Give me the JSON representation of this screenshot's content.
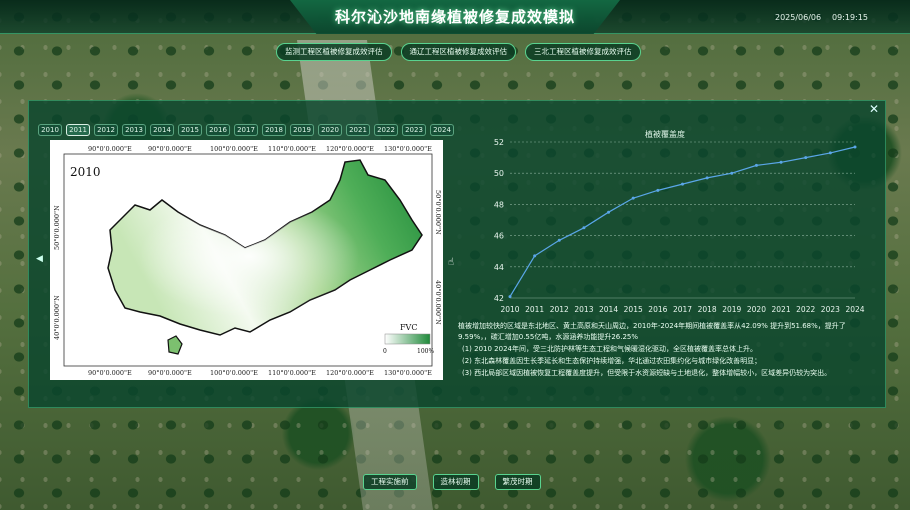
{
  "header": {
    "title": "科尔沁沙地南缘植被修复成效模拟",
    "date": "2025/06/06",
    "time": "09:19:15"
  },
  "top_buttons": [
    "监测工程区植被修复成效评估",
    "通辽工程区植被修复成效评估",
    "三北工程区植被修复成效评估"
  ],
  "years": [
    "2010",
    "2011",
    "2012",
    "2013",
    "2014",
    "2015",
    "2016",
    "2017",
    "2018",
    "2019",
    "2020",
    "2021",
    "2022",
    "2023",
    "2024"
  ],
  "active_year": "2011",
  "map": {
    "year_label": "2010",
    "top_ticks": [
      "90°0'0.000\"E",
      "90°0'0.000\"E",
      "100°0'0.000\"E",
      "110°0'0.000\"E",
      "120°0'0.000\"E",
      "130°0'0.000\"E"
    ],
    "bottom_ticks": [
      "90°0'0.000\"E",
      "90°0'0.000\"E",
      "100°0'0.000\"E",
      "110°0'0.000\"E",
      "120°0'0.000\"E",
      "130°0'0.000\"E"
    ],
    "left_ticks": [
      "50°0'0.000\"N",
      "40°0'0.000\"N"
    ],
    "right_ticks": [
      "50°0'0.000\"N",
      "40°0'0.000\"N"
    ],
    "legend_title": "FVC",
    "legend_min": "0",
    "legend_max": "100%",
    "colors": {
      "low": "#ffffff",
      "high": "#1f8a3a"
    }
  },
  "chart_data": {
    "type": "line",
    "title": "植被覆盖度",
    "x": [
      "2010",
      "2011",
      "2012",
      "2013",
      "2014",
      "2015",
      "2016",
      "2017",
      "2018",
      "2019",
      "2020",
      "2021",
      "2022",
      "2023",
      "2024"
    ],
    "series": [
      {
        "values": [
          42.09,
          44.7,
          45.7,
          46.5,
          47.5,
          48.4,
          48.9,
          49.3,
          49.7,
          50.0,
          50.5,
          50.7,
          51.0,
          51.3,
          51.68
        ]
      }
    ],
    "yticks": [
      "42",
      "44",
      "46",
      "48",
      "50",
      "52"
    ],
    "ylim": [
      42,
      52
    ],
    "grid": true,
    "line_color": "#5aa6e8"
  },
  "description": {
    "summary": "植被增加较快的区域是东北地区、黄土高原和天山周边，2010年-2024年期间植被覆盖率从42.09% 提升到51.68%，提升了9.59%，，碳汇增加0.55亿吨，水源涵养功能提升26.25%",
    "items": [
      "(1)  2010 2024年间，受三北防护林等生态工程和气候暖湿化驱动，全区植被覆盖率总体上升。",
      "(2)  东北森林覆盖因生长季延长和生态保护持续增强，华北通过农田集约化与城市绿化改善明显；",
      "(3)  西北局部区域因植被恢复工程覆盖度提升，但受限于水资源短缺与土地退化，整体增幅较小，区域差异仍较为突出。"
    ]
  },
  "bottom_buttons": [
    "工程实施前",
    "造林初期",
    "繁茂时期"
  ],
  "icons": {
    "close": "close-icon",
    "left": "chevron-left-icon",
    "cursor": "hand-cursor-icon"
  }
}
